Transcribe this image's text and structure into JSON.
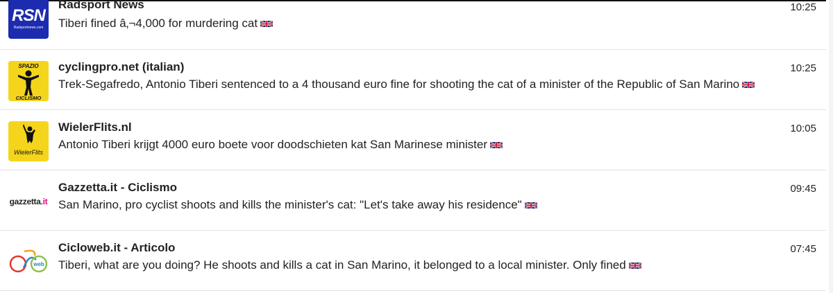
{
  "colors": {
    "text": "#222222",
    "divider": "#e2e2e2",
    "rsn_blue": "#1c2bb0",
    "spazio_yellow": "#f5d51c",
    "gazzetta_pink": "#e6007e"
  },
  "feed": {
    "items": [
      {
        "logo_icon": "radsport-news-logo",
        "logo_text": "RSN",
        "logo_subtext": "Radsportnews.com",
        "source": "Radsport News",
        "headline": "Tiberi fined â‚¬4,000 for murdering cat",
        "flag_icon": "uk-flag-icon",
        "time": "10:25"
      },
      {
        "logo_icon": "spazio-ciclismo-logo",
        "logo_text_top": "SPAZIO",
        "logo_text_bottom": "CICLISMO",
        "source": "cyclingpro.net (italian)",
        "headline": "Trek-Segafredo, Antonio Tiberi sentenced to a 4 thousand euro fine for shooting the cat of a minister of the Republic of San Marino",
        "flag_icon": "uk-flag-icon",
        "time": "10:25"
      },
      {
        "logo_icon": "wielerflits-logo",
        "logo_text": "WielerFlits",
        "source": "WielerFlits.nl",
        "headline": "Antonio Tiberi krijgt 4000 euro boete voor doodschieten kat San Marinese minister",
        "flag_icon": "uk-flag-icon",
        "time": "10:05"
      },
      {
        "logo_icon": "gazzetta-logo",
        "logo_text": "gazzetta",
        "logo_text_suffix": ".it",
        "source": "Gazzetta.it - Ciclismo",
        "headline": "San Marino, pro cyclist shoots and kills the minister's cat: \"Let's take away his residence\"",
        "flag_icon": "uk-flag-icon",
        "time": "09:45"
      },
      {
        "logo_icon": "cicloweb-logo",
        "logo_text": "web",
        "source": "Cicloweb.it - Articolo",
        "headline": "Tiberi, what are you doing? He shoots and kills a cat in San Marino, it belonged to a local minister. Only fined",
        "flag_icon": "uk-flag-icon",
        "time": "07:45"
      }
    ]
  }
}
